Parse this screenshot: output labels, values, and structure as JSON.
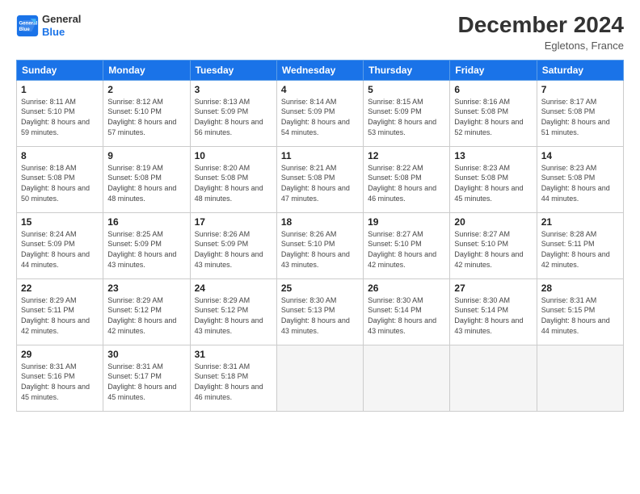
{
  "header": {
    "logo_line1": "General",
    "logo_line2": "Blue",
    "month": "December 2024",
    "location": "Egletons, France"
  },
  "weekdays": [
    "Sunday",
    "Monday",
    "Tuesday",
    "Wednesday",
    "Thursday",
    "Friday",
    "Saturday"
  ],
  "weeks": [
    [
      {
        "day": "1",
        "sunrise": "Sunrise: 8:11 AM",
        "sunset": "Sunset: 5:10 PM",
        "daylight": "Daylight: 8 hours and 59 minutes."
      },
      {
        "day": "2",
        "sunrise": "Sunrise: 8:12 AM",
        "sunset": "Sunset: 5:10 PM",
        "daylight": "Daylight: 8 hours and 57 minutes."
      },
      {
        "day": "3",
        "sunrise": "Sunrise: 8:13 AM",
        "sunset": "Sunset: 5:09 PM",
        "daylight": "Daylight: 8 hours and 56 minutes."
      },
      {
        "day": "4",
        "sunrise": "Sunrise: 8:14 AM",
        "sunset": "Sunset: 5:09 PM",
        "daylight": "Daylight: 8 hours and 54 minutes."
      },
      {
        "day": "5",
        "sunrise": "Sunrise: 8:15 AM",
        "sunset": "Sunset: 5:09 PM",
        "daylight": "Daylight: 8 hours and 53 minutes."
      },
      {
        "day": "6",
        "sunrise": "Sunrise: 8:16 AM",
        "sunset": "Sunset: 5:08 PM",
        "daylight": "Daylight: 8 hours and 52 minutes."
      },
      {
        "day": "7",
        "sunrise": "Sunrise: 8:17 AM",
        "sunset": "Sunset: 5:08 PM",
        "daylight": "Daylight: 8 hours and 51 minutes."
      }
    ],
    [
      {
        "day": "8",
        "sunrise": "Sunrise: 8:18 AM",
        "sunset": "Sunset: 5:08 PM",
        "daylight": "Daylight: 8 hours and 50 minutes."
      },
      {
        "day": "9",
        "sunrise": "Sunrise: 8:19 AM",
        "sunset": "Sunset: 5:08 PM",
        "daylight": "Daylight: 8 hours and 48 minutes."
      },
      {
        "day": "10",
        "sunrise": "Sunrise: 8:20 AM",
        "sunset": "Sunset: 5:08 PM",
        "daylight": "Daylight: 8 hours and 48 minutes."
      },
      {
        "day": "11",
        "sunrise": "Sunrise: 8:21 AM",
        "sunset": "Sunset: 5:08 PM",
        "daylight": "Daylight: 8 hours and 47 minutes."
      },
      {
        "day": "12",
        "sunrise": "Sunrise: 8:22 AM",
        "sunset": "Sunset: 5:08 PM",
        "daylight": "Daylight: 8 hours and 46 minutes."
      },
      {
        "day": "13",
        "sunrise": "Sunrise: 8:23 AM",
        "sunset": "Sunset: 5:08 PM",
        "daylight": "Daylight: 8 hours and 45 minutes."
      },
      {
        "day": "14",
        "sunrise": "Sunrise: 8:23 AM",
        "sunset": "Sunset: 5:08 PM",
        "daylight": "Daylight: 8 hours and 44 minutes."
      }
    ],
    [
      {
        "day": "15",
        "sunrise": "Sunrise: 8:24 AM",
        "sunset": "Sunset: 5:09 PM",
        "daylight": "Daylight: 8 hours and 44 minutes."
      },
      {
        "day": "16",
        "sunrise": "Sunrise: 8:25 AM",
        "sunset": "Sunset: 5:09 PM",
        "daylight": "Daylight: 8 hours and 43 minutes."
      },
      {
        "day": "17",
        "sunrise": "Sunrise: 8:26 AM",
        "sunset": "Sunset: 5:09 PM",
        "daylight": "Daylight: 8 hours and 43 minutes."
      },
      {
        "day": "18",
        "sunrise": "Sunrise: 8:26 AM",
        "sunset": "Sunset: 5:10 PM",
        "daylight": "Daylight: 8 hours and 43 minutes."
      },
      {
        "day": "19",
        "sunrise": "Sunrise: 8:27 AM",
        "sunset": "Sunset: 5:10 PM",
        "daylight": "Daylight: 8 hours and 42 minutes."
      },
      {
        "day": "20",
        "sunrise": "Sunrise: 8:27 AM",
        "sunset": "Sunset: 5:10 PM",
        "daylight": "Daylight: 8 hours and 42 minutes."
      },
      {
        "day": "21",
        "sunrise": "Sunrise: 8:28 AM",
        "sunset": "Sunset: 5:11 PM",
        "daylight": "Daylight: 8 hours and 42 minutes."
      }
    ],
    [
      {
        "day": "22",
        "sunrise": "Sunrise: 8:29 AM",
        "sunset": "Sunset: 5:11 PM",
        "daylight": "Daylight: 8 hours and 42 minutes."
      },
      {
        "day": "23",
        "sunrise": "Sunrise: 8:29 AM",
        "sunset": "Sunset: 5:12 PM",
        "daylight": "Daylight: 8 hours and 42 minutes."
      },
      {
        "day": "24",
        "sunrise": "Sunrise: 8:29 AM",
        "sunset": "Sunset: 5:12 PM",
        "daylight": "Daylight: 8 hours and 43 minutes."
      },
      {
        "day": "25",
        "sunrise": "Sunrise: 8:30 AM",
        "sunset": "Sunset: 5:13 PM",
        "daylight": "Daylight: 8 hours and 43 minutes."
      },
      {
        "day": "26",
        "sunrise": "Sunrise: 8:30 AM",
        "sunset": "Sunset: 5:14 PM",
        "daylight": "Daylight: 8 hours and 43 minutes."
      },
      {
        "day": "27",
        "sunrise": "Sunrise: 8:30 AM",
        "sunset": "Sunset: 5:14 PM",
        "daylight": "Daylight: 8 hours and 43 minutes."
      },
      {
        "day": "28",
        "sunrise": "Sunrise: 8:31 AM",
        "sunset": "Sunset: 5:15 PM",
        "daylight": "Daylight: 8 hours and 44 minutes."
      }
    ],
    [
      {
        "day": "29",
        "sunrise": "Sunrise: 8:31 AM",
        "sunset": "Sunset: 5:16 PM",
        "daylight": "Daylight: 8 hours and 45 minutes."
      },
      {
        "day": "30",
        "sunrise": "Sunrise: 8:31 AM",
        "sunset": "Sunset: 5:17 PM",
        "daylight": "Daylight: 8 hours and 45 minutes."
      },
      {
        "day": "31",
        "sunrise": "Sunrise: 8:31 AM",
        "sunset": "Sunset: 5:18 PM",
        "daylight": "Daylight: 8 hours and 46 minutes."
      },
      null,
      null,
      null,
      null
    ]
  ]
}
